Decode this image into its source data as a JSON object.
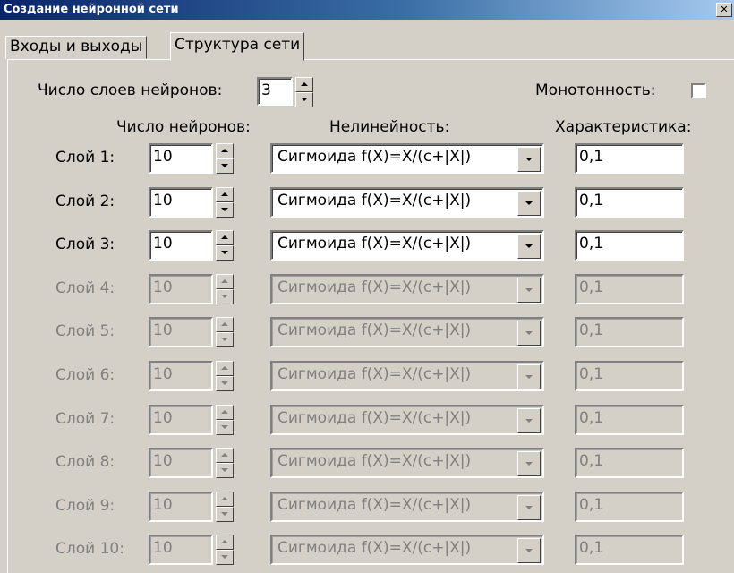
{
  "window": {
    "title": "Создание нейронной сети",
    "close_label": "✕"
  },
  "tabs": [
    "Входы и выходы",
    "Структура сети"
  ],
  "layer_count": {
    "label": "Число слоев нейронов:",
    "value": "3"
  },
  "monotonic": {
    "label": "Монотонность:",
    "checked": false
  },
  "headers": {
    "neurons": "Число нейронов:",
    "nonlinearity": "Нелинейность:",
    "characteristic": "Характеристика:"
  },
  "layers": [
    {
      "label": "Слой 1:",
      "neurons": "10",
      "function": "Сигмоида f(X)=X/(c+|X|)",
      "char": "0,1",
      "enabled": true
    },
    {
      "label": "Слой 2:",
      "neurons": "10",
      "function": "Сигмоида f(X)=X/(c+|X|)",
      "char": "0,1",
      "enabled": true
    },
    {
      "label": "Слой 3:",
      "neurons": "10",
      "function": "Сигмоида f(X)=X/(c+|X|)",
      "char": "0,1",
      "enabled": true
    },
    {
      "label": "Слой 4:",
      "neurons": "10",
      "function": "Сигмоида f(X)=X/(c+|X|)",
      "char": "0,1",
      "enabled": false
    },
    {
      "label": "Слой 5:",
      "neurons": "10",
      "function": "Сигмоида f(X)=X/(c+|X|)",
      "char": "0,1",
      "enabled": false
    },
    {
      "label": "Слой 6:",
      "neurons": "10",
      "function": "Сигмоида f(X)=X/(c+|X|)",
      "char": "0,1",
      "enabled": false
    },
    {
      "label": "Слой 7:",
      "neurons": "10",
      "function": "Сигмоида f(X)=X/(c+|X|)",
      "char": "0,1",
      "enabled": false
    },
    {
      "label": "Слой 8:",
      "neurons": "10",
      "function": "Сигмоида f(X)=X/(c+|X|)",
      "char": "0,1",
      "enabled": false
    },
    {
      "label": "Слой 9:",
      "neurons": "10",
      "function": "Сигмоида f(X)=X/(c+|X|)",
      "char": "0,1",
      "enabled": false
    },
    {
      "label": "Слой 10:",
      "neurons": "10",
      "function": "Сигмоида f(X)=X/(c+|X|)",
      "char": "0,1",
      "enabled": false
    }
  ]
}
